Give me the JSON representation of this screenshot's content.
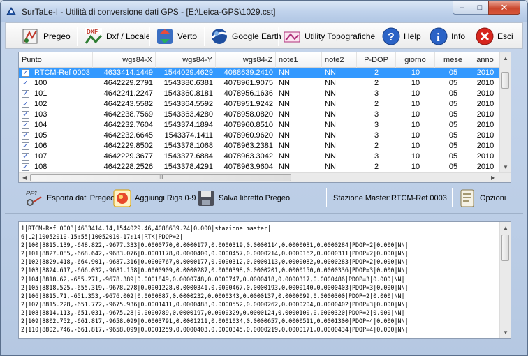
{
  "window": {
    "title": "SurTaLe-I - Utilità di conversione dati GPS - [E:\\Leica-GPS\\1029.cst]",
    "caption_min": "–",
    "caption_max": "□",
    "caption_close": "✕"
  },
  "toolbar": {
    "items": [
      {
        "label": "Pregeo",
        "icon": "pregeo-icon"
      },
      {
        "label": "Dxf / Locale",
        "icon": "dxf-icon"
      },
      {
        "label": "Verto",
        "icon": "verto-icon"
      },
      {
        "label": "Google Earth",
        "icon": "google-earth-icon"
      },
      {
        "label": "Utility Topografiche",
        "icon": "utility-icon"
      },
      {
        "label": "Help",
        "icon": "help-icon"
      },
      {
        "label": "Info",
        "icon": "info-icon"
      },
      {
        "label": "Esci",
        "icon": "exit-icon"
      }
    ]
  },
  "grid": {
    "columns": [
      "Punto",
      "wgs84-X",
      "wgs84-Y",
      "wgs84-Z",
      "note1",
      "note2",
      "P-DOP",
      "giorno",
      "mese",
      "anno"
    ],
    "rows": [
      {
        "checked": true,
        "selected": true,
        "cells": [
          "RTCM-Ref 0003",
          "4633414.1449",
          "1544029.4629",
          "4088639.2410",
          "NN",
          "NN",
          "2",
          "10",
          "05",
          "2010"
        ]
      },
      {
        "checked": true,
        "selected": false,
        "cells": [
          "100",
          "4642229.2791",
          "1543380.6381",
          "4078961.9075",
          "NN",
          "NN",
          "2",
          "10",
          "05",
          "2010"
        ]
      },
      {
        "checked": true,
        "selected": false,
        "cells": [
          "101",
          "4642241.2247",
          "1543360.8181",
          "4078956.1636",
          "NN",
          "NN",
          "3",
          "10",
          "05",
          "2010"
        ]
      },
      {
        "checked": true,
        "selected": false,
        "cells": [
          "102",
          "4642243.5582",
          "1543364.5592",
          "4078951.9242",
          "NN",
          "NN",
          "2",
          "10",
          "05",
          "2010"
        ]
      },
      {
        "checked": true,
        "selected": false,
        "cells": [
          "103",
          "4642238.7569",
          "1543363.4280",
          "4078958.0820",
          "NN",
          "NN",
          "3",
          "10",
          "05",
          "2010"
        ]
      },
      {
        "checked": true,
        "selected": false,
        "cells": [
          "104",
          "4642232.7604",
          "1543374.1894",
          "4078960.8510",
          "NN",
          "NN",
          "3",
          "10",
          "05",
          "2010"
        ]
      },
      {
        "checked": true,
        "selected": false,
        "cells": [
          "105",
          "4642232.6645",
          "1543374.1411",
          "4078960.9620",
          "NN",
          "NN",
          "3",
          "10",
          "05",
          "2010"
        ]
      },
      {
        "checked": true,
        "selected": false,
        "cells": [
          "106",
          "4642229.8502",
          "1543378.1068",
          "4078963.2381",
          "NN",
          "NN",
          "2",
          "10",
          "05",
          "2010"
        ]
      },
      {
        "checked": true,
        "selected": false,
        "cells": [
          "107",
          "4642229.3677",
          "1543377.6884",
          "4078963.3042",
          "NN",
          "NN",
          "3",
          "10",
          "05",
          "2010"
        ]
      },
      {
        "checked": true,
        "selected": false,
        "cells": [
          "108",
          "4642228.2526",
          "1543378.4291",
          "4078963.9604",
          "NN",
          "NN",
          "2",
          "10",
          "05",
          "2010"
        ]
      }
    ],
    "hscroll_grip": "III"
  },
  "toolbar2": {
    "export_label": "Esporta dati Pregeo",
    "add_row_label": "Aggiungi Riga 0-9",
    "save_label": "Salva libretto Pregeo",
    "master_label": "Stazione Master:",
    "master_value": "RTCM-Ref 0003",
    "options_label": "Opzioni"
  },
  "log": {
    "lines": [
      "1|RTCM-Ref 0003|4633414.14,1544029.46,4088639.24|0.000|stazione master|",
      "6|L2|10052010-15:55|10052010-17:14|RTK|PDOP=2|",
      "2|100|8815.139,-648.822,-9677.333|0.0000770,0.0000177,0.0000319,0.0000114,0.0000081,0.0000284|PDOP=2|0.000|NN|",
      "2|101|8827.085,-668.642,-9683.076|0.0001178,0.0000400,0.0000457,0.0000214,0.0000162,0.0000311|PDOP=2|0.000|NN|",
      "2|102|8829.418,-664.901,-9687.316|0.0000767,0.0000177,0.0000312,0.0000113,0.0000082,0.0000283|PDOP=2|0.000|NN|",
      "2|103|8824.617,-666.032,-9681.158|0.0000909,0.0000287,0.0000398,0.0000201,0.0000150,0.0000336|PDOP=3|0.000|NN|",
      "2|104|8818.62,-655.271,-9678.389|0.0001849,0.0000748,0.0000747,0.0000418,0.0000317,0.0000486|PDOP=3|0.000|NN|",
      "2|105|8818.525,-655.319,-9678.278|0.0001228,0.0000341,0.0000467,0.0000193,0.0000140,0.0000403|PDOP=3|0.000|NN|",
      "2|106|8815.71,-651.353,-9676.002|0.0000887,0.0000232,0.0000343,0.0000137,0.0000099,0.0000300|PDOP=2|0.000|NN|",
      "2|107|8815.228,-651.772,-9675.936|0.0001411,0.0000488,0.0000552,0.0000262,0.0000204,0.0000402|PDOP=3|0.000|NN|",
      "2|108|8814.113,-651.031,-9675.28|0.0000789,0.0000197,0.0000329,0.0000124,0.0000100,0.0000320|PDOP=2|0.000|NN|",
      "2|109|8802.752,-661.817,-9658.099|0.0003791,0.0001211,0.0001034,0.0000657,0.0000511,0.0001300|PDOP=4|0.000|NN|",
      "2|110|8802.746,-661.817,-9658.099|0.0001259,0.0000403,0.0000345,0.0000219,0.0000171,0.0000434|PDOP=4|0.000|NN|"
    ]
  },
  "colors": {
    "selection": "#3399ff",
    "title_bar": "#c1d3ec",
    "close_button": "#c9472d"
  }
}
